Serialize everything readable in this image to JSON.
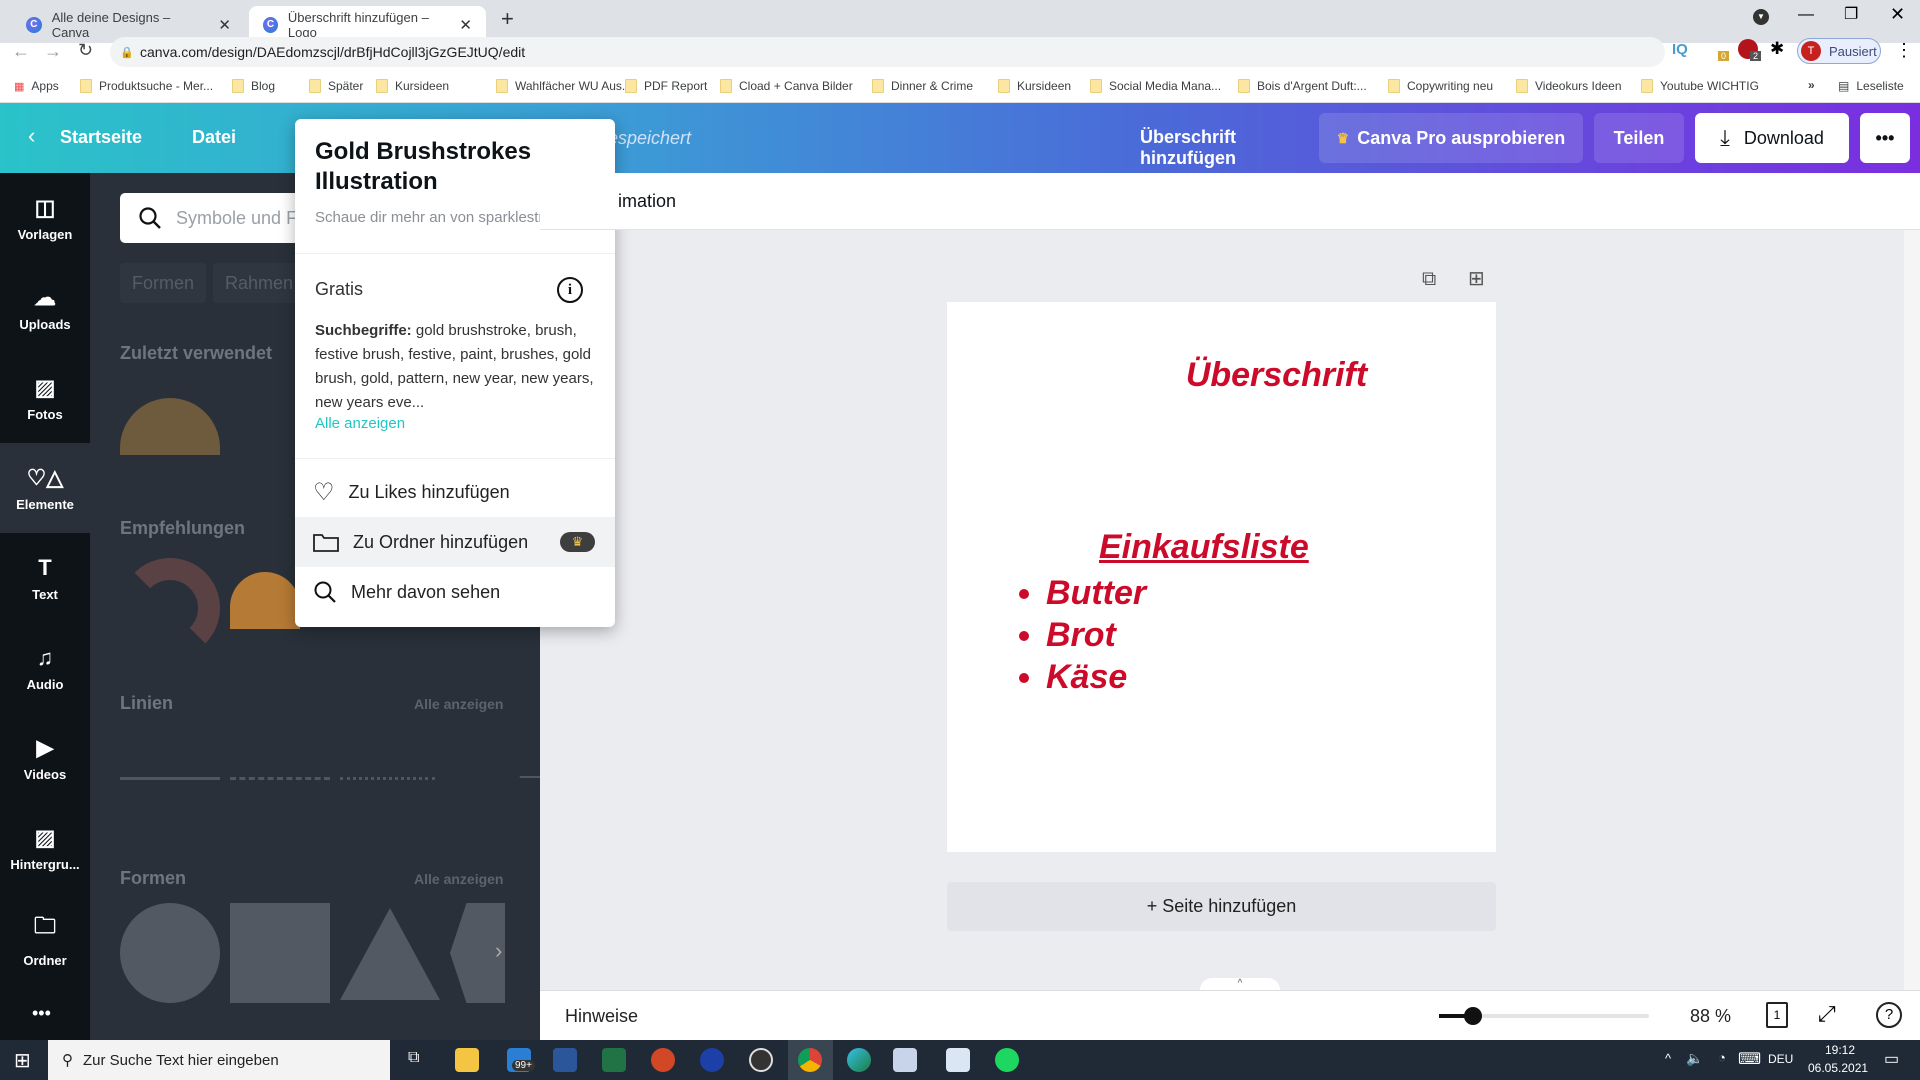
{
  "browser": {
    "tabs": [
      {
        "title": "Alle deine Designs – Canva",
        "active": false
      },
      {
        "title": "Überschrift hinzufügen – Logo",
        "active": true
      }
    ],
    "url": "canva.com/design/DAEdomzscjl/drBfjHdCojll3jGzGEJtUQ/edit",
    "profile": {
      "initial": "T",
      "status": "Pausiert"
    },
    "extension_badges": {
      "ext1": "0",
      "abp": "2"
    },
    "extension_iq": "IQ",
    "bookmarks": [
      "Apps",
      "Produktsuche - Mer...",
      "Blog",
      "Später",
      "Kursideen",
      "Wahlfächer WU Aus...",
      "PDF Report",
      "Cload + Canva Bilder",
      "Dinner & Crime",
      "Kursideen",
      "Social Media Mana...",
      "Bois d'Argent Duft:...",
      "Copywriting neu",
      "Videokurs Ideen",
      "Youtube WICHTIG"
    ],
    "bookmarks_more": "»",
    "reading_list": "Leseliste"
  },
  "header": {
    "home": "Startseite",
    "file": "Datei",
    "saved": "espeichert",
    "design_title": "Überschrift hinzufügen",
    "pro": "Canva Pro ausprobieren",
    "share": "Teilen",
    "download": "Download",
    "more": "•••"
  },
  "rail": [
    {
      "label": "Vorlagen",
      "icon": "template-icon"
    },
    {
      "label": "Uploads",
      "icon": "upload-cloud-icon"
    },
    {
      "label": "Fotos",
      "icon": "photo-icon"
    },
    {
      "label": "Elemente",
      "icon": "elements-icon",
      "active": true
    },
    {
      "label": "Text",
      "icon": "text-icon"
    },
    {
      "label": "Audio",
      "icon": "music-icon"
    },
    {
      "label": "Videos",
      "icon": "video-icon"
    },
    {
      "label": "Hintergru...",
      "icon": "background-icon"
    },
    {
      "label": "Ordner",
      "icon": "folder-icon"
    }
  ],
  "panel": {
    "search_placeholder": "Symbole und F",
    "chips": [
      "Formen",
      "Rahmen"
    ],
    "recent": "Zuletzt verwendet",
    "recommended": "Empfehlungen",
    "lines": "Linien",
    "shapes": "Formen",
    "see_all": "Alle anzeigen"
  },
  "popup": {
    "title": "Gold Brushstrokes Illustration",
    "subtitle": "Schaue dir mehr an von sparklestroke.",
    "price": "Gratis",
    "keywords_label": "Suchbegriffe:",
    "keywords": "gold brushstroke, brush, festive brush, festive, paint, brushes, gold brush, gold, pattern, new year, new years, new years eve...",
    "see_all": "Alle anzeigen",
    "menu": [
      "Zu Likes hinzufügen",
      "Zu Ordner hinzufügen",
      "Mehr davon sehen"
    ]
  },
  "toolbar": {
    "animation": "imation"
  },
  "canvas": {
    "heading": "Überschrift",
    "list_title": "Einkaufsliste",
    "items": [
      "Butter",
      "Brot",
      "Käse"
    ],
    "text_color": "#cc0a2a"
  },
  "add_page": "+ Seite hinzufügen",
  "bottom": {
    "notes": "Hinweise",
    "zoom": "88 %",
    "zoom_fraction": 0.16,
    "page_count": "1",
    "help": "?"
  },
  "taskbar": {
    "search": "Zur Suche Text hier eingeben",
    "mail_badge": "99+",
    "lang": "DEU",
    "time": "19:12",
    "date": "06.05.2021"
  }
}
